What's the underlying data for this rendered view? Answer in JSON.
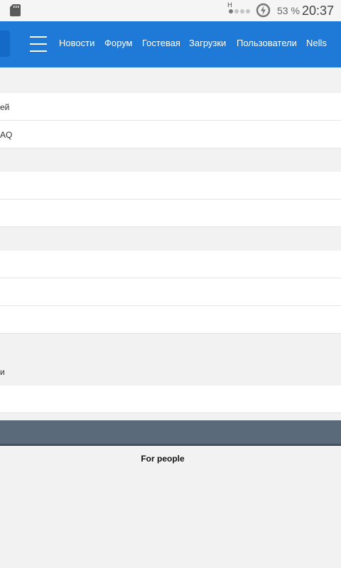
{
  "status_bar": {
    "signal_label": "H",
    "battery_percent": "53 %",
    "time": "20:37",
    "icons": [
      "sd-card-icon",
      "signal-icon",
      "battery-charging-icon"
    ]
  },
  "navbar": {
    "menu_icon": "hamburger-icon",
    "links": [
      "Новости",
      "Форум",
      "Гостевая",
      "Загрузки",
      "Пользователи",
      "Nells"
    ],
    "background": "#1e7ad6"
  },
  "content": {
    "rows": [
      {
        "text": "ей"
      },
      {
        "text": "AQ"
      },
      {
        "text": ""
      },
      {
        "text": ""
      },
      {
        "text": ""
      },
      {
        "text": ""
      },
      {
        "text": ""
      },
      {
        "text": ""
      }
    ],
    "band_text": "и"
  },
  "footer": {
    "text": "For people",
    "bar_color": "#5a6a7b"
  }
}
